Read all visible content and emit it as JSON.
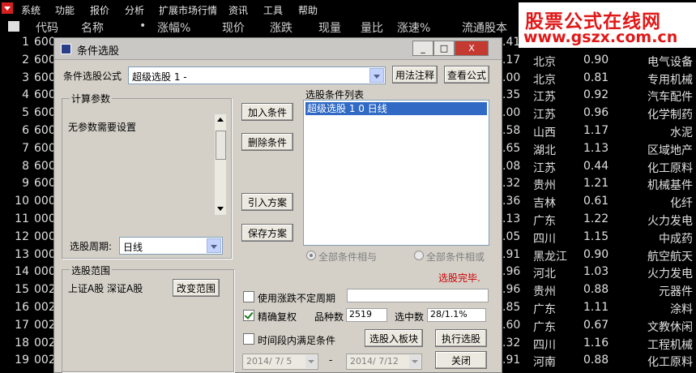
{
  "menu": [
    "系统",
    "功能",
    "报价",
    "分析",
    "扩展市场行情",
    "资讯",
    "工具",
    "帮助"
  ],
  "header": {
    "cols": [
      "代码",
      "名称",
      "•",
      "涨幅%",
      "现价",
      "涨跌",
      "现量",
      "量比",
      "涨速%",
      "流通股本"
    ]
  },
  "watermark": {
    "line1": "股票公式在线网",
    "line2": "www.gszx.com.cn"
  },
  "rows": [
    {
      "num": "1",
      "code": "600",
      "v1": ".41",
      "region": "",
      "val": "",
      "ind": ""
    },
    {
      "num": "2",
      "code": "600",
      "v1": ".17",
      "region": "北京",
      "val": "0.90",
      "ind": "电气设备"
    },
    {
      "num": "3",
      "code": "600",
      "v1": ".00",
      "region": "北京",
      "val": "0.81",
      "ind": "专用机械"
    },
    {
      "num": "4",
      "code": "600",
      "v1": ".35",
      "region": "江苏",
      "val": "0.92",
      "ind": "汽车配件"
    },
    {
      "num": "5",
      "code": "600",
      "v1": ".00",
      "region": "江苏",
      "val": "0.96",
      "ind": "化学制药"
    },
    {
      "num": "6",
      "code": "600",
      "v1": ".58",
      "region": "山西",
      "val": "1.17",
      "ind": "水泥"
    },
    {
      "num": "7",
      "code": "600",
      "v1": ".65",
      "region": "湖北",
      "val": "1.13",
      "ind": "区域地产"
    },
    {
      "num": "8",
      "code": "600",
      "v1": ".08",
      "region": "江苏",
      "val": "0.44",
      "ind": "化工原料"
    },
    {
      "num": "9",
      "code": "600",
      "v1": ".32",
      "region": "贵州",
      "val": "1.21",
      "ind": "机械基件"
    },
    {
      "num": "10",
      "code": "000",
      "v1": ".36",
      "region": "吉林",
      "val": "0.61",
      "ind": "化纤"
    },
    {
      "num": "11",
      "code": "000",
      "v1": ".13",
      "region": "广东",
      "val": "1.22",
      "ind": "火力发电"
    },
    {
      "num": "12",
      "code": "000",
      "v1": ".05",
      "region": "四川",
      "val": "1.15",
      "ind": "中成药"
    },
    {
      "num": "13",
      "code": "000",
      "v1": ".91",
      "region": "黑龙江",
      "val": "0.90",
      "ind": "航空航天"
    },
    {
      "num": "14",
      "code": "000",
      "v1": ".96",
      "region": "河北",
      "val": "1.03",
      "ind": "火力发电"
    },
    {
      "num": "15",
      "code": "002",
      "v1": ".96",
      "region": "贵州",
      "val": "0.88",
      "ind": "元器件"
    },
    {
      "num": "16",
      "code": "002",
      "v1": ".85",
      "region": "广东",
      "val": "1.11",
      "ind": "涂料"
    },
    {
      "num": "17",
      "code": "002",
      "v1": ".60",
      "region": "广东",
      "val": "0.67",
      "ind": "文教休闲"
    },
    {
      "num": "18",
      "code": "002",
      "v1": ".32",
      "region": "四川",
      "val": "1.16",
      "ind": "工程机械"
    },
    {
      "num": "19",
      "code": "002",
      "v1": ".91",
      "region": "河南",
      "val": "0.88",
      "ind": "化工原料"
    }
  ],
  "dialog": {
    "title": "条件选股",
    "title_buttons": [
      "_",
      "□",
      "X"
    ],
    "formula_label": "条件选股公式",
    "formula_value": "超级选股 1 -",
    "usage_btn": "用法注释",
    "view_btn": "查看公式",
    "calc_group": "计算参数",
    "no_params": "无参数需要设置",
    "period_label": "选股周期:",
    "period_value": "日线",
    "add_btn": "加入条件",
    "del_btn": "删除条件",
    "import_btn": "引入方案",
    "save_btn": "保存方案",
    "cond_list_label": "选股条件列表",
    "cond_items": [
      "超级选股 1  0  日线"
    ],
    "radio_and": "全部条件相与",
    "radio_or": "全部条件相或",
    "status": "选股完毕.",
    "range_group": "选股范围",
    "range_value": "上证A股 深证A股",
    "change_range_btn": "改变范围",
    "cb_uncertain": "使用涨跌不定周期",
    "cb_exact": "精确复权",
    "count_label": "品种数",
    "count_value": "2519",
    "hit_label": "选中数",
    "hit_value": "28/1.1%",
    "cb_period": "时间段内满足条件",
    "to_board_btn": "选股入板块",
    "exec_btn": "执行选股",
    "date_from": "2014/ 7/ 5",
    "date_dash": "-",
    "date_to": "2014/ 7/12",
    "close_btn": "关闭",
    "colors": {
      "selection": "#316ac5",
      "status": "#cc0000",
      "face": "#d4d0c8"
    }
  }
}
